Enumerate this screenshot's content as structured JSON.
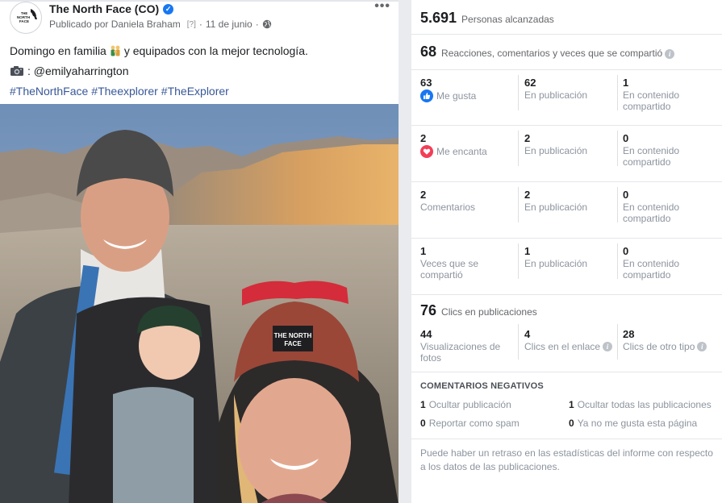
{
  "post": {
    "page_name": "The North Face (CO)",
    "published_by": "Publicado por Daniela Braham",
    "qmark": "[?]",
    "date": "11 de junio",
    "text_line1_a": "Domingo en familia",
    "text_line1_b": "y equipados con la mejor tecnología.",
    "credit": ": @emilyaharrington",
    "hashtags": [
      "#TheNorthFace",
      "#Theexplorer",
      "#TheExplorer"
    ],
    "avatar_logo_lines": [
      "THE",
      "NORTH",
      "FACE"
    ]
  },
  "insights": {
    "reach": {
      "value": "5.691",
      "label": "Personas alcanzadas"
    },
    "engagement": {
      "value": "68",
      "label": "Reacciones, comentarios y veces que se compartió"
    },
    "rows": [
      {
        "c1_value": "63",
        "c1_label": "Me gusta",
        "c2_value": "62",
        "c2_label": "En publicación",
        "c3_value": "1",
        "c3_label": "En contenido compartido"
      },
      {
        "c1_value": "2",
        "c1_label": "Me encanta",
        "c2_value": "2",
        "c2_label": "En publicación",
        "c3_value": "0",
        "c3_label": "En contenido compartido"
      },
      {
        "c1_value": "2",
        "c1_label": "Comentarios",
        "c2_value": "2",
        "c2_label": "En publicación",
        "c3_value": "0",
        "c3_label": "En contenido compartido"
      },
      {
        "c1_value": "1",
        "c1_label": "Veces que se compartió",
        "c2_value": "1",
        "c2_label": "En publicación",
        "c3_value": "0",
        "c3_label": "En contenido compartido"
      }
    ],
    "clicks": {
      "value": "76",
      "label": "Clics en publicaciones",
      "items": [
        {
          "value": "44",
          "label": "Visualizaciones de fotos"
        },
        {
          "value": "4",
          "label": "Clics en el enlace"
        },
        {
          "value": "28",
          "label": "Clics de otro tipo"
        }
      ]
    },
    "negative": {
      "title": "COMENTARIOS NEGATIVOS",
      "items": [
        {
          "value": "1",
          "label": "Ocultar publicación"
        },
        {
          "value": "1",
          "label": "Ocultar todas las publicaciones"
        },
        {
          "value": "0",
          "label": "Reportar como spam"
        },
        {
          "value": "0",
          "label": "Ya no me gusta esta página"
        }
      ]
    },
    "footnote": "Puede haber un retraso en las estadísticas del informe con respecto a los datos de las publicaciones."
  },
  "colors": {
    "brand_blue": "#1877f2",
    "love_red": "#f33e58",
    "link": "#385898",
    "muted": "#8d949e"
  },
  "icons": [
    "verified-icon",
    "globe-icon",
    "more-icon",
    "family-emoji-icon",
    "camera-icon",
    "like-icon",
    "love-icon",
    "info-icon"
  ]
}
